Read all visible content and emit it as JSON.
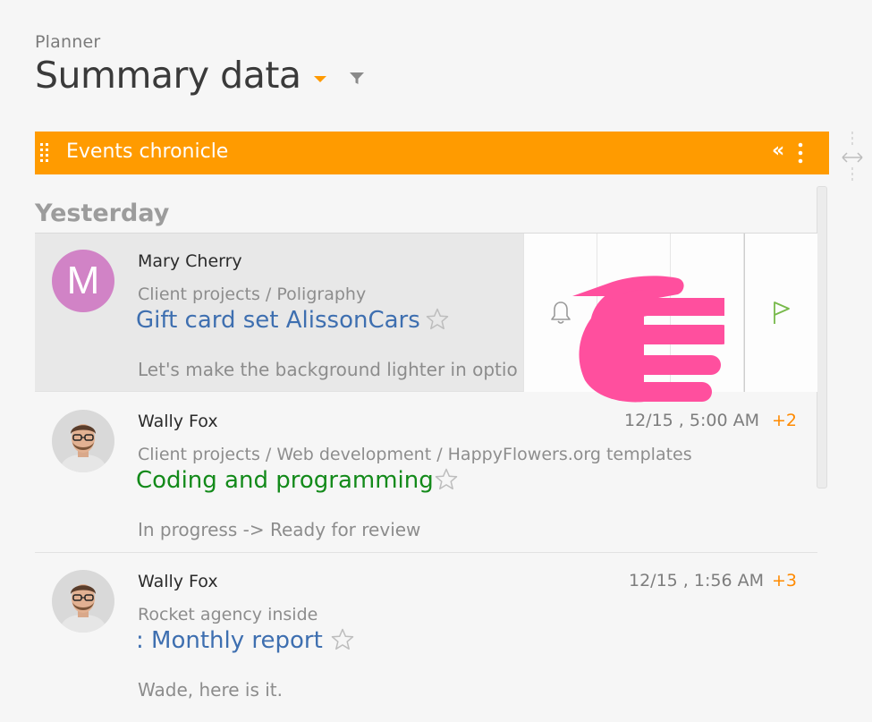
{
  "header": {
    "app_label": "Planner",
    "page_title": "Summary data"
  },
  "panel": {
    "title": "Events chronicle",
    "collapse_glyph": "«"
  },
  "group": {
    "label": "Yesterday"
  },
  "items": [
    {
      "avatar_letter": "M",
      "author": "Mary Cherry",
      "path": "Client projects / Poligraphy",
      "title": "Gift card set AlissonCars",
      "message": "Let's make the background lighter in optio",
      "datetime": "",
      "counter": ""
    },
    {
      "author": "Wally Fox",
      "path": "Client projects / Web development / HappyFlowers.org templates",
      "title": "Coding and programming",
      "message": "In progress -> Ready for review",
      "datetime": "12/15 , 5:00 AM",
      "counter": "+2"
    },
    {
      "author": "Wally Fox",
      "path": "Rocket agency inside",
      "title": ": Monthly report",
      "message": "Wade, here is it.",
      "datetime": "12/15 , 1:56 AM",
      "counter": "+3"
    }
  ],
  "colors": {
    "accent": "#ff9b00",
    "link_blue": "#3e6fb0",
    "link_green": "#138a1a",
    "counter_orange": "#ff8a00",
    "avatar_pink": "#d183c6",
    "pointer_pink": "#ff4f9e"
  },
  "icons": {
    "filter": "filter-icon",
    "drag": "drag-handle-icon",
    "collapse": "double-chevron-left-icon",
    "menu": "kebab-menu-icon",
    "star": "star-outline-icon",
    "bell": "bell-icon",
    "flag": "flag-icon",
    "resize": "horizontal-resize-icon"
  }
}
